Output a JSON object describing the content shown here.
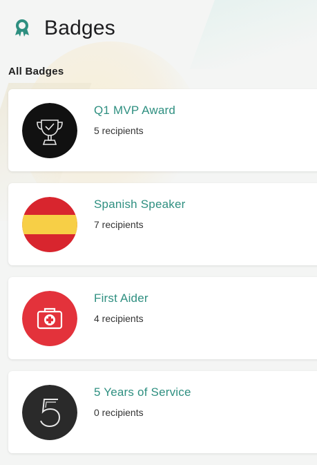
{
  "header": {
    "title": "Badges",
    "icon": "badge-ribbon-icon",
    "accent": "#2e8f80"
  },
  "section": {
    "title": "All Badges"
  },
  "badges": [
    {
      "name": "Q1 MVP Award",
      "recipients": "5 recipients",
      "icon": "trophy-icon"
    },
    {
      "name": "Spanish Speaker",
      "recipients": "7 recipients",
      "icon": "spain-flag-icon"
    },
    {
      "name": "First Aider",
      "recipients": "4 recipients",
      "icon": "first-aid-kit-icon"
    },
    {
      "name": "5 Years of Service",
      "recipients": "0 recipients",
      "icon": "number-five-icon"
    }
  ],
  "colors": {
    "badge_name": "#2e8f80",
    "spain_red": "#d8252e",
    "spain_yellow": "#f7cf46",
    "first_aid_red": "#e3323b",
    "trophy_bg": "#111111",
    "five_bg": "#2a2a2a"
  }
}
